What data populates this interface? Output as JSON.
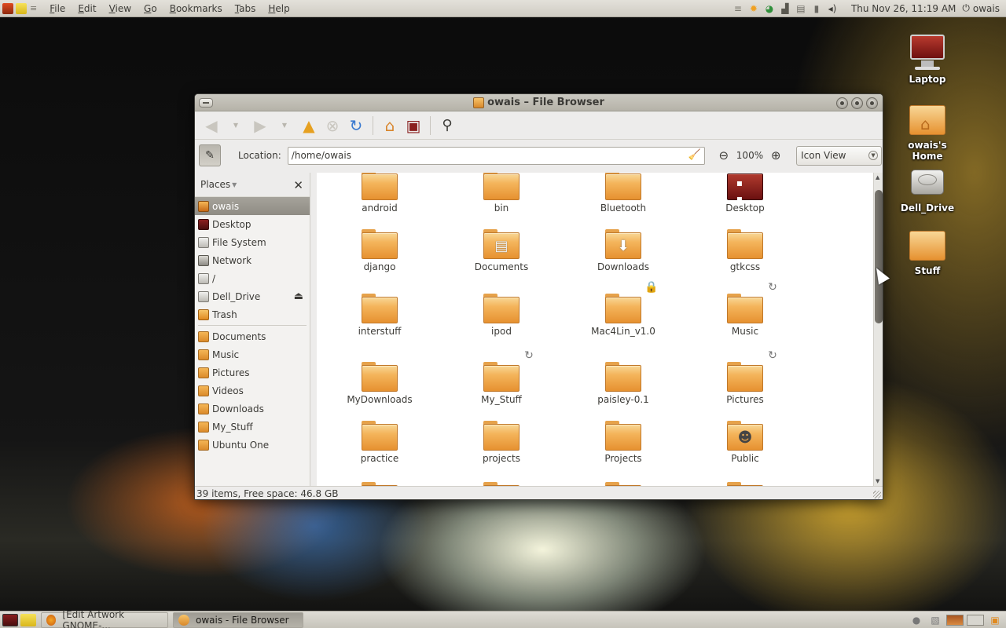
{
  "top_panel": {
    "menu": [
      "File",
      "Edit",
      "View",
      "Go",
      "Bookmarks",
      "Tabs",
      "Help"
    ],
    "clock": "Thu Nov 26, 11:19 AM",
    "user": "owais"
  },
  "desktop_icons": [
    {
      "label": "Laptop",
      "icon": "computer-icon"
    },
    {
      "label": "owais's Home",
      "icon": "home-folder-icon"
    },
    {
      "label": "Dell_Drive",
      "icon": "hard-drive-icon"
    },
    {
      "label": "Stuff",
      "icon": "folder-icon"
    }
  ],
  "window": {
    "title": "owais – File Browser",
    "location_label": "Location:",
    "location_value": "/home/owais",
    "zoom": "100%",
    "view_mode": "Icon View",
    "status": "39 items, Free space: 46.8 GB"
  },
  "sidebar": {
    "header": "Places",
    "places": [
      {
        "label": "owais",
        "icon": "home-icon",
        "selected": true
      },
      {
        "label": "Desktop",
        "icon": "desktop-icon"
      },
      {
        "label": "File System",
        "icon": "drive-icon"
      },
      {
        "label": "Network",
        "icon": "network-icon"
      },
      {
        "label": "/",
        "icon": "drive-icon"
      },
      {
        "label": "Dell_Drive",
        "icon": "drive-icon",
        "eject": true
      },
      {
        "label": "Trash",
        "icon": "trash-icon"
      }
    ],
    "bookmarks": [
      {
        "label": "Documents",
        "icon": "documents-icon"
      },
      {
        "label": "Music",
        "icon": "folder-icon"
      },
      {
        "label": "Pictures",
        "icon": "folder-icon"
      },
      {
        "label": "Videos",
        "icon": "folder-icon"
      },
      {
        "label": "Downloads",
        "icon": "downloads-icon"
      },
      {
        "label": "My_Stuff",
        "icon": "folder-icon"
      },
      {
        "label": "Ubuntu One",
        "icon": "folder-icon"
      }
    ]
  },
  "files": [
    {
      "name": "android"
    },
    {
      "name": "bin"
    },
    {
      "name": "Bluetooth"
    },
    {
      "name": "Desktop",
      "kind": "desktop"
    },
    {
      "name": "django"
    },
    {
      "name": "Documents",
      "kind": "documents"
    },
    {
      "name": "Downloads",
      "kind": "downloads"
    },
    {
      "name": "gtkcss"
    },
    {
      "name": "interstuff"
    },
    {
      "name": "ipod"
    },
    {
      "name": "Mac4Lin_v1.0",
      "emblem": "lock"
    },
    {
      "name": "Music",
      "emblem": "link"
    },
    {
      "name": "MyDownloads"
    },
    {
      "name": "My_Stuff",
      "emblem": "link"
    },
    {
      "name": "paisley-0.1"
    },
    {
      "name": "Pictures",
      "emblem": "link"
    },
    {
      "name": "practice"
    },
    {
      "name": "projects"
    },
    {
      "name": "Projects"
    },
    {
      "name": "Public",
      "kind": "public"
    }
  ],
  "taskbar": {
    "tasks": [
      {
        "label": "[Edit Artwork GNOME-...",
        "active": false
      },
      {
        "label": "owais - File Browser",
        "active": true
      }
    ]
  }
}
